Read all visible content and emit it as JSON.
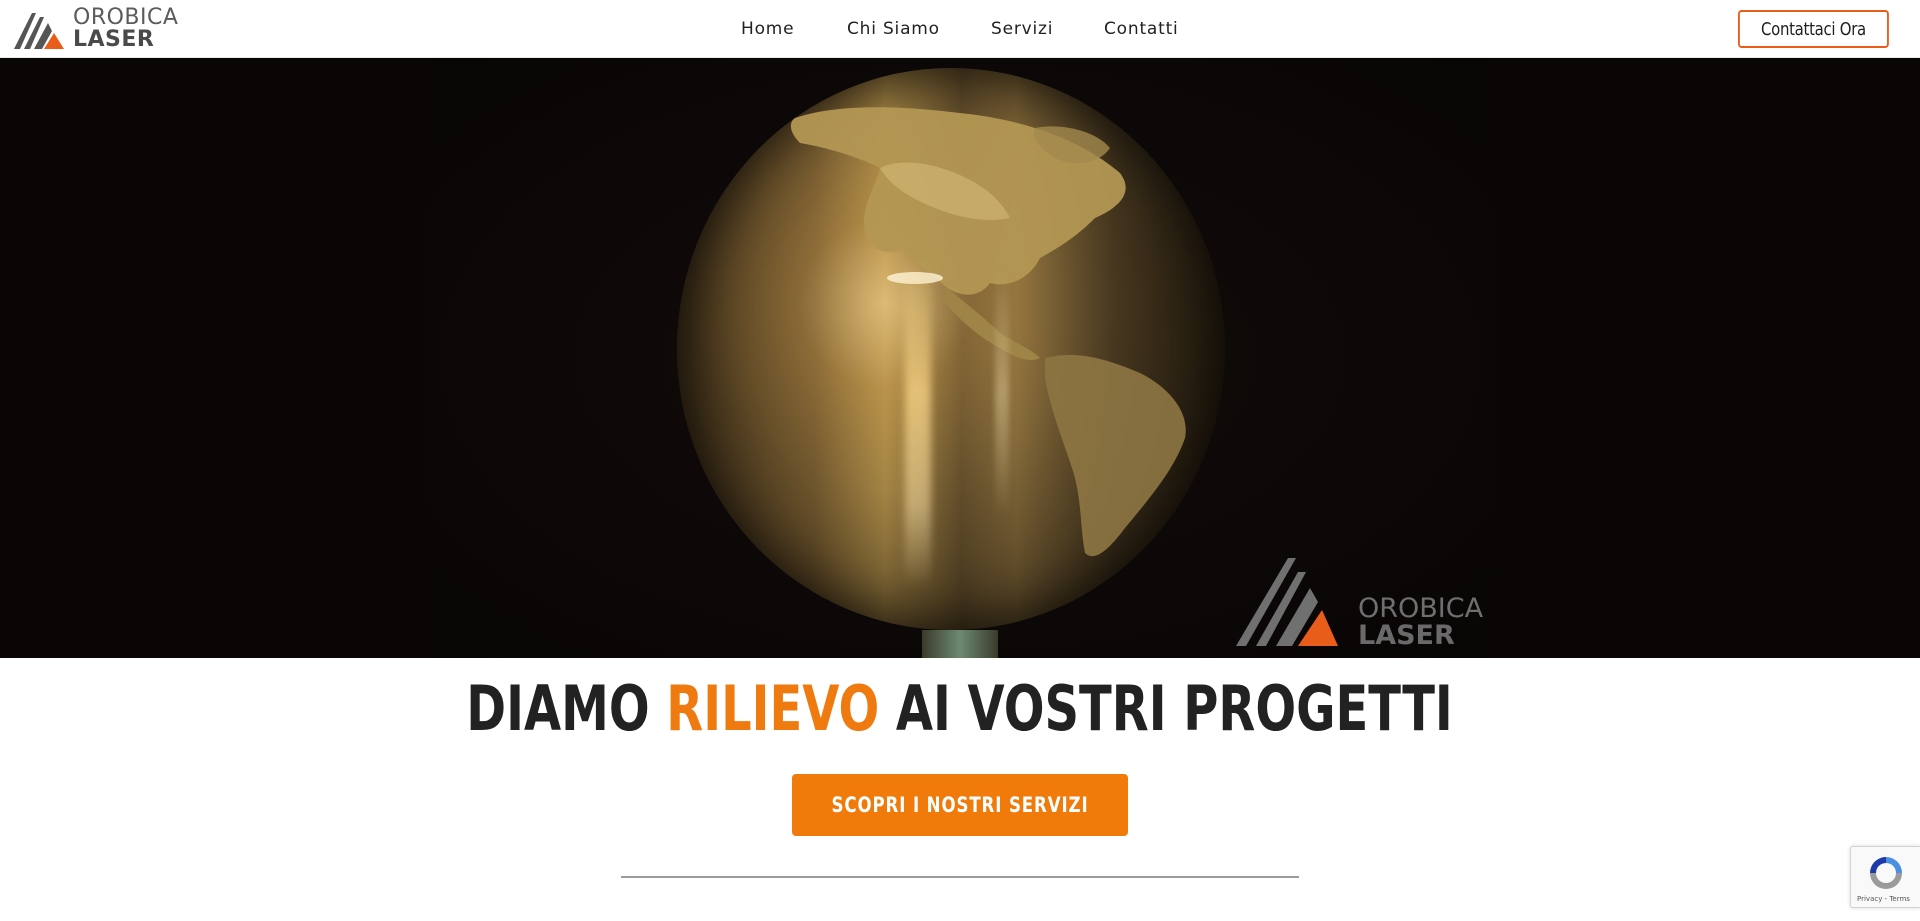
{
  "brand": {
    "name_top": "OROBICA",
    "name_bottom": "LASER",
    "accent_color": "#e85d1a"
  },
  "nav": {
    "items": [
      {
        "label": "Home"
      },
      {
        "label": "Chi Siamo"
      },
      {
        "label": "Servizi"
      },
      {
        "label": "Contatti"
      }
    ],
    "contact_button": "Contattaci Ora"
  },
  "hero": {
    "media": "video-frame",
    "watermark_top": "OROBICA",
    "watermark_bottom": "LASER"
  },
  "main": {
    "headline_part1": "DIAMO ",
    "headline_highlight": "RILIEVO",
    "headline_part2": " AI VOSTRI PROGETTI",
    "highlight_color": "#ee7a10",
    "cta_label": "SCOPRI I NOSTRI SERVIZI",
    "cta_color": "#f07a0a"
  },
  "recaptcha": {
    "terms": "Privacy - Terms"
  }
}
